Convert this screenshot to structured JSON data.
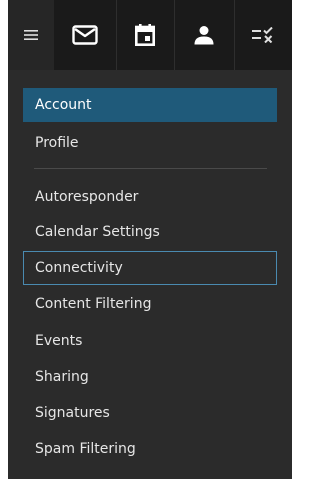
{
  "toolbar": {
    "buttons": [
      {
        "icon": "hamburger-menu-icon"
      },
      {
        "icon": "mail-icon"
      },
      {
        "icon": "calendar-icon"
      },
      {
        "icon": "contacts-icon"
      },
      {
        "icon": "tasks-icon"
      }
    ]
  },
  "menu": {
    "items": [
      {
        "label": "Account",
        "state": "selected"
      },
      {
        "label": "Profile"
      },
      {
        "label": "Autoresponder"
      },
      {
        "label": "Calendar Settings"
      },
      {
        "label": "Connectivity",
        "state": "focused"
      },
      {
        "label": "Content Filtering"
      },
      {
        "label": "Events"
      },
      {
        "label": "Sharing"
      },
      {
        "label": "Signatures"
      },
      {
        "label": "Spam Filtering"
      }
    ]
  },
  "colors": {
    "panel_bg": "#2b2b2b",
    "toolbar_bg": "#1a1a1a",
    "selected_bg": "#1f5a7a",
    "focus_border": "#4a8ab0",
    "text": "#e6e6e6"
  }
}
